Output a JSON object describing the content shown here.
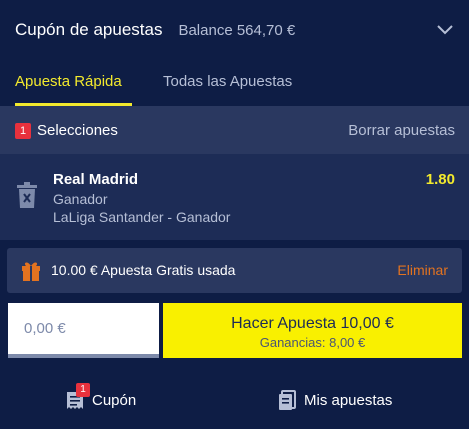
{
  "header": {
    "title": "Cupón de apuestas",
    "balance": "Balance 564,70 €",
    "chevron_icon": "chevron-down-icon"
  },
  "tabs": [
    {
      "label": "Apuesta Rápida",
      "active": true
    },
    {
      "label": "Todas las Apuestas",
      "active": false
    }
  ],
  "selections": {
    "count": "1",
    "label": "Selecciones",
    "clear_label": "Borrar apuestas"
  },
  "bet": {
    "team": "Real Madrid",
    "market": "Ganador",
    "league": "LaLiga Santander - Ganador",
    "odds": "1.80",
    "remove_icon": "trash-icon"
  },
  "free_bet": {
    "text": "10.00 € Apuesta Gratis usada",
    "remove_label": "Eliminar",
    "icon": "gift-icon"
  },
  "stake": {
    "placeholder": "0,00 €"
  },
  "place_bet": {
    "label": "Hacer Apuesta 10,00 €",
    "winnings": "Ganancias:  8,00 €"
  },
  "footer": {
    "coupon_label": "Cupón",
    "coupon_badge": "1",
    "mybets_label": "Mis apuestas"
  },
  "colors": {
    "background": "#0e1d45",
    "accent_yellow": "#f3ea2d",
    "badge_red": "#e8313d",
    "remove_orange": "#e37320"
  }
}
